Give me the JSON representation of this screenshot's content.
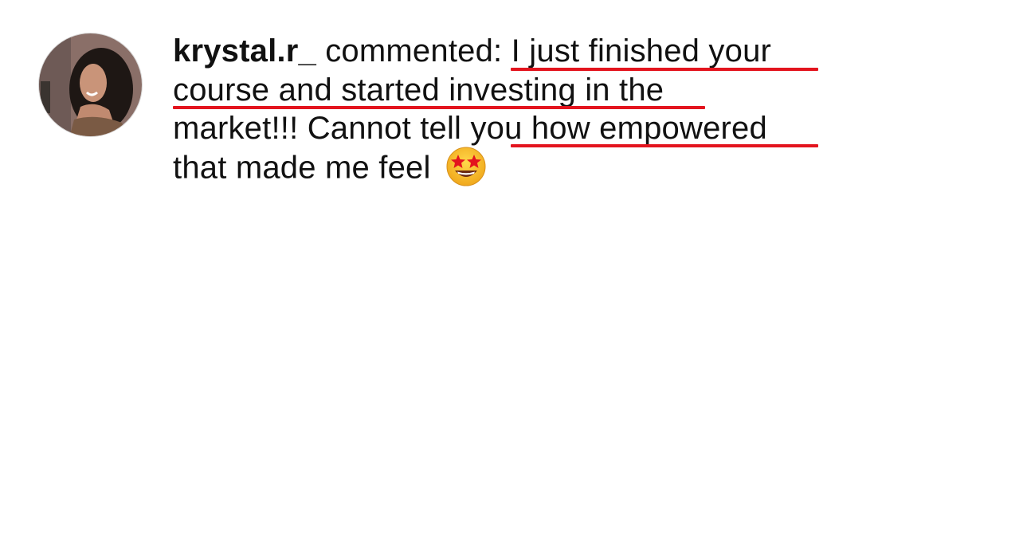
{
  "comment": {
    "username": "krystal.r_",
    "action": " commented",
    "lines": [
      ": I just finished your",
      "course and started investing in the",
      "market!!! Cannot tell you how empowered",
      "that made me feel"
    ],
    "emoji": "star-struck-emoji"
  },
  "colors": {
    "underline": "#e3141e",
    "text": "#111111",
    "background": "#ffffff"
  }
}
